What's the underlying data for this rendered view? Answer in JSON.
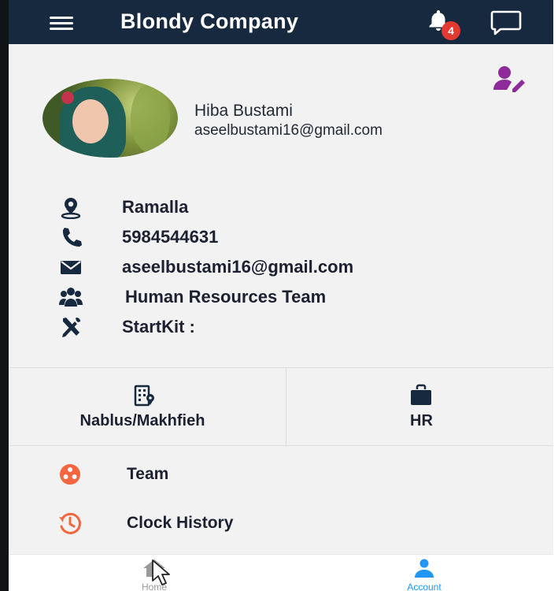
{
  "header": {
    "title": "Blondy Company",
    "menu_icon": "hamburger-menu-icon",
    "notification_icon": "bell-icon",
    "notification_count": "4",
    "chat_icon": "chat-bubble-icon"
  },
  "profile": {
    "edit_icon": "edit-profile-icon",
    "name": "Hiba Bustami",
    "email": "aseelbustami16@gmail.com"
  },
  "details": [
    {
      "icon": "location-pin-icon",
      "text": "Ramalla"
    },
    {
      "icon": "phone-icon",
      "text": "5984544631"
    },
    {
      "icon": "envelope-icon",
      "text": "aseelbustami16@gmail.com"
    },
    {
      "icon": "team-group-icon",
      "text": "Human Resources Team"
    },
    {
      "icon": "tools-icon",
      "text": "StartKit :"
    }
  ],
  "stats": [
    {
      "icon": "building-location-icon",
      "label": "Nablus/Makhfieh"
    },
    {
      "icon": "briefcase-icon",
      "label": "HR"
    }
  ],
  "menu": [
    {
      "icon": "team-circle-icon",
      "label": "Team"
    },
    {
      "icon": "clock-history-icon",
      "label": "Clock History"
    }
  ],
  "bottom_nav": [
    {
      "icon": "home-icon",
      "label": "Home",
      "active": false
    },
    {
      "icon": "account-icon",
      "label": "Account",
      "active": true
    }
  ],
  "colors": {
    "header_bg": "#16293f",
    "badge_red": "#e23a31",
    "edit_purple": "#8e2a9a",
    "menu_orange": "#f4663d",
    "active_blue": "#2196f3"
  }
}
